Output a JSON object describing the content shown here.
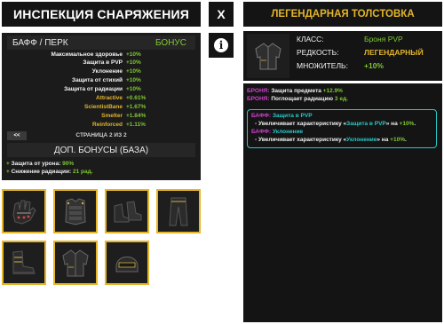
{
  "left_header": {
    "title": "ИНСПЕКЦИЯ СНАРЯЖЕНИЯ"
  },
  "close_button": {
    "label": "X"
  },
  "stats": {
    "header_left": "БАФФ / ПЕРК",
    "header_right": "БОНУС",
    "rows": [
      {
        "name": "Максимальное здоровье",
        "value": "+10%"
      },
      {
        "name": "Защита в PVP",
        "value": "+10%"
      },
      {
        "name": "Уклонение",
        "value": "+10%"
      },
      {
        "name": "Защита от стихий",
        "value": "+10%"
      },
      {
        "name": "Защита от радиации",
        "value": "+10%"
      },
      {
        "name": "Attractive",
        "value": "+0.61%"
      },
      {
        "name": "ScientistBane",
        "value": "+1.67%"
      },
      {
        "name": "Smelter",
        "value": "+1.84%"
      },
      {
        "name": "Reinforced",
        "value": "+1.11%"
      }
    ],
    "back_label": "<<",
    "page_label": "СТРАНИЦА 2 ИЗ 2",
    "extra_header": "ДОП. БОНУСЫ (БАЗА)",
    "extra": [
      {
        "plus": "+",
        "text": "Защита от урона:",
        "value": "90%"
      },
      {
        "plus": "+",
        "text": "Снижение радиации:",
        "value": "21 рад."
      }
    ]
  },
  "gear": [
    "gloves",
    "chest-armor",
    "boots-pair",
    "pants",
    "boots",
    "hoodie",
    "helmet"
  ],
  "right": {
    "title": "ЛЕГЕНДАРНАЯ ТОЛСТОВКА",
    "class_key": "КЛАСС:",
    "class_val": "Броня PVP",
    "rarity_key": "РЕДКОСТЬ:",
    "rarity_val": "ЛЕГЕНДАРНЫЙ",
    "mult_key": "МНОЖИТЕЛЬ:",
    "mult_val": "+10%",
    "line1_tag": "БРОНЯ:",
    "line1_text": "Защита предмета",
    "line1_val": "+12.9%",
    "line2_tag": "БРОНЯ:",
    "line2_text": "Поглощает радиацию",
    "line2_val": "3 ед.",
    "b1_tag": "БАФФ:",
    "b1_name": "Защита в PVP",
    "b1_pre": "- Увеличивает характеристику «",
    "b1_char": "Защита в PVP",
    "b1_mid": "» на",
    "b1_val": "+10%",
    "b1_end": ".",
    "b2_tag": "БАФФ:",
    "b2_name": "Уклонение",
    "b2_pre": "- Увеличивает характеристику «",
    "b2_char": "Уклонение",
    "b2_mid": "» на",
    "b2_val": "+10%",
    "b2_end": "."
  },
  "colors": {
    "gold": "#e5b625",
    "green": "#7ec832",
    "cyan": "#27c9c9",
    "magenta": "#d13fd1",
    "panel": "#141414"
  }
}
